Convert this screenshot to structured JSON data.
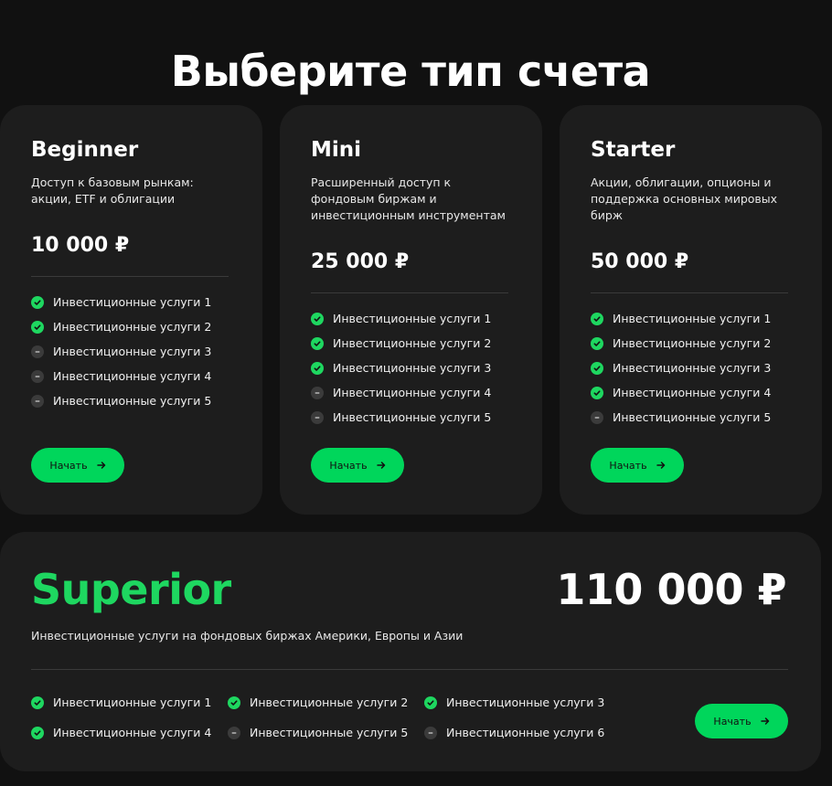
{
  "page": {
    "title": "Выберите тип счета"
  },
  "plans": [
    {
      "name": "Beginner",
      "description": "Доступ к базовым рынкам: акции, ETF и облигации",
      "price": "10 000 ₽",
      "features": [
        {
          "label": "Инвестиционные услуги 1",
          "included": true
        },
        {
          "label": "Инвестиционные услуги 2",
          "included": true
        },
        {
          "label": "Инвестиционные услуги 3",
          "included": false
        },
        {
          "label": "Инвестиционные услуги 4",
          "included": false
        },
        {
          "label": "Инвестиционные услуги 5",
          "included": false
        }
      ],
      "button_label": "Начать"
    },
    {
      "name": "Mini",
      "description": "Расширенный доступ к фондовым биржам и инвестиционным инструментам",
      "price": "25 000 ₽",
      "features": [
        {
          "label": "Инвестиционные услуги 1",
          "included": true
        },
        {
          "label": "Инвестиционные услуги 2",
          "included": true
        },
        {
          "label": "Инвестиционные услуги 3",
          "included": true
        },
        {
          "label": "Инвестиционные услуги 4",
          "included": false
        },
        {
          "label": "Инвестиционные услуги 5",
          "included": false
        }
      ],
      "button_label": "Начать"
    },
    {
      "name": "Starter",
      "description": "Акции, облигации, опционы и поддержка основных мировых бирж",
      "price": "50 000 ₽",
      "features": [
        {
          "label": "Инвестиционные услуги 1",
          "included": true
        },
        {
          "label": "Инвестиционные услуги 2",
          "included": true
        },
        {
          "label": "Инвестиционные услуги 3",
          "included": true
        },
        {
          "label": "Инвестиционные услуги 4",
          "included": true
        },
        {
          "label": "Инвестиционные услуги 5",
          "included": false
        }
      ],
      "button_label": "Начать"
    }
  ],
  "superior": {
    "name": "Superior",
    "price": "110 000 ₽",
    "description": "Инвестиционные услуги на фондовых биржах Америки, Европы и Азии",
    "features": [
      {
        "label": "Инвестиционные услуги 1",
        "included": true
      },
      {
        "label": "Инвестиционные услуги 2",
        "included": true
      },
      {
        "label": "Инвестиционные услуги 3",
        "included": true
      },
      {
        "label": "Инвестиционные услуги 4",
        "included": true
      },
      {
        "label": "Инвестиционные услуги 5",
        "included": false
      },
      {
        "label": "Инвестиционные услуги 6",
        "included": false
      }
    ],
    "button_label": "Начать"
  },
  "icons": {
    "included": "check-icon",
    "excluded": "minus-icon",
    "button": "arrow-right-icon"
  },
  "colors": {
    "background": "#111111",
    "card": "#1d1d1d",
    "accent": "#00d65b",
    "text": "#ffffff",
    "excluded_mark": "#3b3b3b"
  }
}
